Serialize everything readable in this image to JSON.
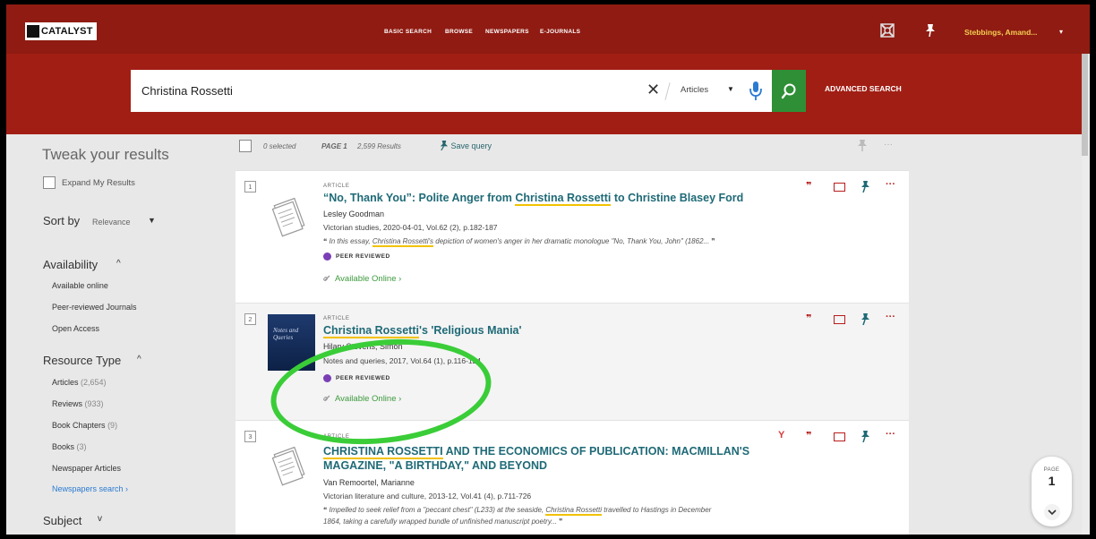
{
  "topbar": {
    "logo_text": "CATALYST",
    "nav": [
      "BASIC SEARCH",
      "BROWSE",
      "NEWSPAPERS",
      "E-JOURNALS"
    ],
    "user": "Stebbings, Amand...",
    "user_caret": "▾",
    "icons": [
      "feedback-icon",
      "pin-icon"
    ]
  },
  "search": {
    "query": "Christina Rossetti",
    "clear": "✕",
    "scope": "Articles",
    "scope_caret": "▼",
    "advanced": "ADVANCED SEARCH"
  },
  "sidebar": {
    "heading": "Tweak your results",
    "expand_label": "Expand My Results",
    "sort_label": "Sort by",
    "sort_value": "Relevance",
    "sort_caret": "▼",
    "availability": {
      "title": "Availability",
      "caret": "^",
      "items": [
        "Available online",
        "Peer-reviewed Journals",
        "Open Access"
      ]
    },
    "resource_type": {
      "title": "Resource Type",
      "caret": "^",
      "items": [
        {
          "label": "Articles",
          "count": "(2,654)"
        },
        {
          "label": "Reviews",
          "count": "(933)"
        },
        {
          "label": "Book Chapters",
          "count": "(9)"
        },
        {
          "label": "Books",
          "count": "(3)"
        },
        {
          "label": "Newspaper Articles",
          "count": ""
        }
      ],
      "newspapers_search": "Newspapers search ›"
    },
    "subject": {
      "title": "Subject",
      "caret": "v"
    }
  },
  "results_bar": {
    "selected": "0 selected",
    "page": "PAGE 1",
    "count": "2,599 Results",
    "save_query": "Save query",
    "more": "···"
  },
  "results": [
    {
      "num": "1",
      "type": "ARTICLE",
      "title_pre": "“No, Thank You”: Polite Anger from ",
      "title_hl": "Christina Rossetti",
      "title_post": " to Christine Blasey Ford",
      "author": "Lesley Goodman",
      "source": "Victorian studies, 2020-04-01, Vol.62 (2), p.182-187",
      "snippet_pre": "❝ In this essay, ",
      "snippet_hl": "Christina Rossetti's",
      "snippet_post": " depiction of women's anger in her dramatic monologue \"No, Thank You, John\" (1862... ❞",
      "peer": "PEER REVIEWED",
      "avail": "Available Online ›"
    },
    {
      "num": "2",
      "type": "ARTICLE",
      "title_hl": "Christina Rossetti",
      "title_post": "'s 'Religious Mania'",
      "author": "Hilary Stevens, Simon",
      "source": "Notes and queries, 2017, Vol.64 (1), p.116-124",
      "cover_text": "Notes and Queries",
      "peer": "PEER REVIEWED",
      "avail": "Available Online ›"
    },
    {
      "num": "3",
      "type": "ARTICLE",
      "title_hl": "CHRISTINA ROSSETTI",
      "title_post": " AND THE ECONOMICS OF PUBLICATION: MACMILLAN'S",
      "title_line2": "MAGAZINE, \"A BIRTHDAY,\" AND BEYOND",
      "author": "Van Remoortel, Marianne",
      "source": "Victorian literature and culture, 2013-12, Vol.41 (4), p.711-726",
      "snippet_pre": "❝ Impelled to seek relief from a \"peccant chest\" (L233) at the seaside, ",
      "snippet_hl": "Christina Rossetti",
      "snippet_post": " travelled to Hastings in December",
      "snippet_line2": "1864, taking a carefully wrapped bundle of unfinished manuscript poetry... ❞"
    }
  ],
  "actions": {
    "quote": "❞",
    "dots": "···",
    "sfx": "Y"
  },
  "pager": {
    "label": "PAGE",
    "num": "1"
  },
  "colors": {
    "brand_red": "#8f1b12",
    "search_band": "#a11e14",
    "search_green": "#2f8f36",
    "user_yellow": "#f4ce52",
    "title_teal": "#1f6a77",
    "highlight": "#f2c200",
    "annotation_circle": "#3acd38"
  }
}
